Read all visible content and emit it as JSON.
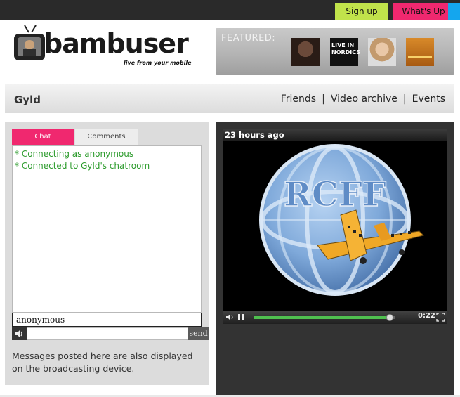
{
  "topbar": {
    "signup_label": "Sign up",
    "whatsup_label": "What's Up"
  },
  "logo": {
    "wordmark": "bambuser",
    "tagline": "live from your mobile"
  },
  "featured": {
    "label": "FEATURED:",
    "thumb2_text": "LIVE IN NORDICS"
  },
  "user": {
    "name": "Gyld",
    "nav": [
      "Friends",
      "Video archive",
      "Events"
    ]
  },
  "chat": {
    "tabs": [
      "Chat",
      "Comments"
    ],
    "active_tab": "Chat",
    "messages": [
      "* Connecting as anonymous",
      "* Connected to Gyld's chatroom"
    ],
    "nickname": "anonymous",
    "send_label": "send",
    "note": "Messages posted here are also displayed on the broadcasting device."
  },
  "video": {
    "title": "23 hours ago",
    "overlay_text": "RCFF",
    "time": "0:22",
    "progress": 0.97
  },
  "colors": {
    "signup": "#c1e34b",
    "whatsup": "#f0286f",
    "accent_blue": "#14a6ee",
    "chat_text": "#2c9b2c",
    "seek": "#4fc04f"
  }
}
